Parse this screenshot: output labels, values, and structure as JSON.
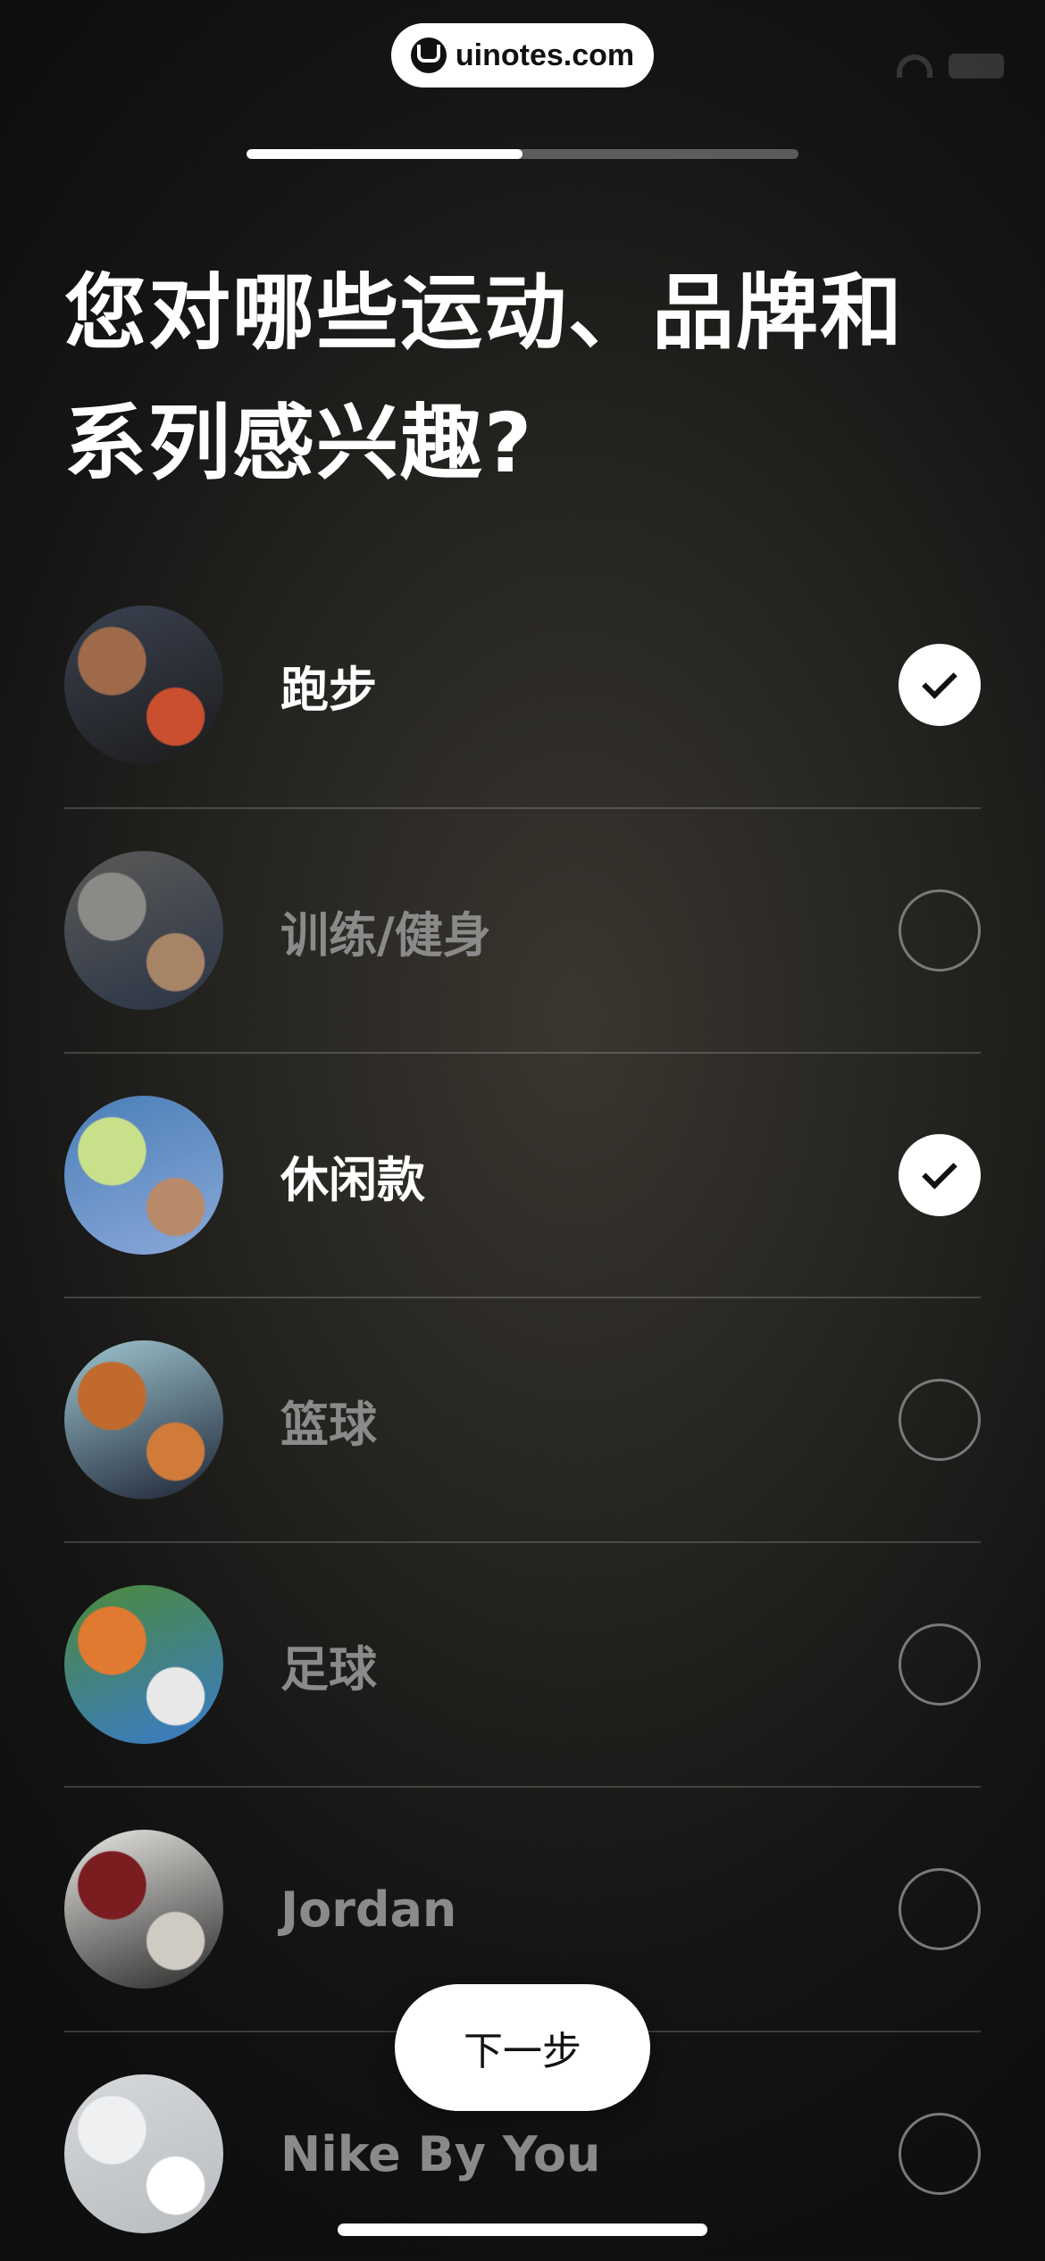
{
  "watermark": {
    "text": "uinotes.com"
  },
  "progress": {
    "value": 0.5
  },
  "title": "您对哪些运动、品牌和系列感兴趣?",
  "items": [
    {
      "label": "跑步",
      "selected": true,
      "colors": [
        "#3a4150",
        "#9e6a4a",
        "#1c1c1c",
        "#c94f2e"
      ]
    },
    {
      "label": "训练/健身",
      "selected": false,
      "colors": [
        "#5a5a58",
        "#8c8a86",
        "#2b3446",
        "#a88466"
      ]
    },
    {
      "label": "休闲款",
      "selected": true,
      "colors": [
        "#4a7fb8",
        "#c8e08a",
        "#8aa8d8",
        "#b98a6a"
      ]
    },
    {
      "label": "篮球",
      "selected": false,
      "colors": [
        "#9fc6cf",
        "#c06a2e",
        "#1d2436",
        "#d07b3a"
      ]
    },
    {
      "label": "足球",
      "selected": false,
      "colors": [
        "#4c8a3a",
        "#e07a30",
        "#3a7acb",
        "#e8e8e8"
      ]
    },
    {
      "label": "Jordan",
      "selected": false,
      "colors": [
        "#e8e6e2",
        "#7a1c20",
        "#2a2a2a",
        "#cfcac2"
      ]
    },
    {
      "label": "Nike By You",
      "selected": false,
      "colors": [
        "#d6d8da",
        "#eef0f2",
        "#b8bcc0",
        "#ffffff"
      ]
    }
  ],
  "next_button": {
    "label": "下一步"
  }
}
